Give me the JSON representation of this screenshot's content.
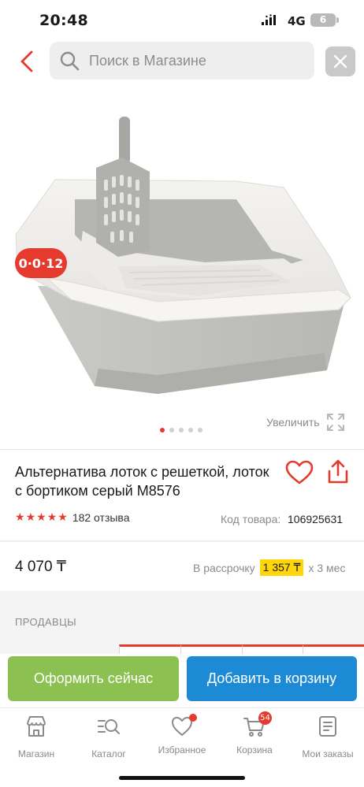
{
  "status_bar": {
    "time": "20:48",
    "network": "4G",
    "battery": "6"
  },
  "search": {
    "placeholder": "Поиск в Магазине"
  },
  "product": {
    "timer": "0·0·12",
    "zoom_label": "Увеличить",
    "gallery_count": 5,
    "gallery_active_index": 0,
    "title": "Альтернатива лоток с решеткой, лоток с бортиком серый M8576",
    "rating_stars": 5,
    "reviews": "182 отзыва",
    "code_label": "Код товара:",
    "code_value": "106925631",
    "price": "4 070 ₸",
    "installment_prefix": "В рассрочку",
    "installment_price": "1 357 ₸",
    "installment_suffix": "x 3 мес"
  },
  "sellers": {
    "label": "ПРОДАВЦЫ"
  },
  "actions": {
    "buy_now": "Оформить сейчас",
    "add_to_cart": "Добавить в корзину"
  },
  "nav": {
    "items": [
      {
        "label": "Магазин",
        "icon": "shop-icon"
      },
      {
        "label": "Каталог",
        "icon": "catalog-search-icon"
      },
      {
        "label": "Избранное",
        "icon": "heart-icon"
      },
      {
        "label": "Корзина",
        "icon": "cart-icon"
      },
      {
        "label": "Мои заказы",
        "icon": "orders-icon"
      }
    ],
    "cart_count": "54"
  },
  "colors": {
    "accent": "#e63a2e",
    "buy_now": "#8cc152",
    "add_to_cart": "#1d8ad6",
    "installment_highlight": "#ffd60a"
  }
}
